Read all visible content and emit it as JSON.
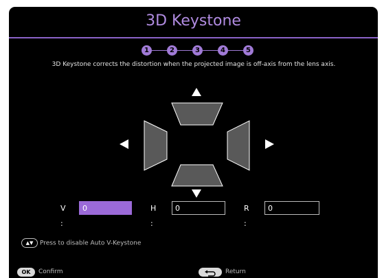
{
  "dialog": {
    "title": "3D Keystone",
    "description": "3D Keystone corrects the distortion when the projected image is off-axis from the lens axis."
  },
  "steps": [
    "1",
    "2",
    "3",
    "4",
    "5"
  ],
  "fields": {
    "v": {
      "label": "V :",
      "value": "0"
    },
    "h": {
      "label": "H :",
      "value": "0"
    },
    "r": {
      "label": "R :",
      "value": "0"
    }
  },
  "hint": {
    "text": "Press to disable Auto V-Keystone"
  },
  "footer": {
    "ok_key": "OK",
    "confirm_label": "Confirm",
    "return_label": "Return"
  },
  "colors": {
    "accent": "#9b6ad8",
    "title": "#b08be0",
    "background": "#000000"
  }
}
